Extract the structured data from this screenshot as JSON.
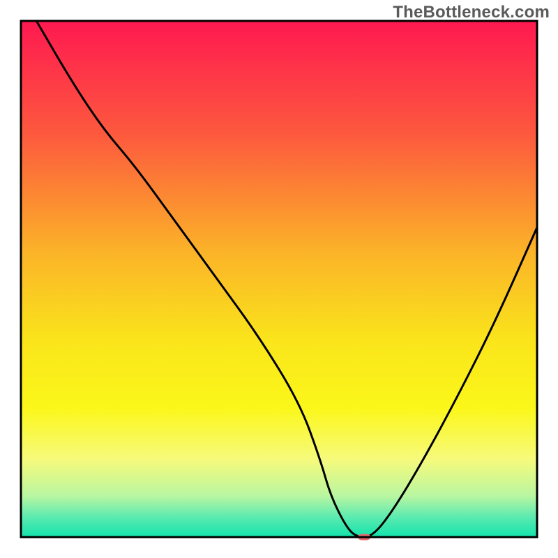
{
  "watermark": "TheBottleneck.com",
  "chart_data": {
    "type": "line",
    "title": "",
    "xlabel": "",
    "ylabel": "",
    "xlim": [
      0,
      100
    ],
    "ylim": [
      0,
      100
    ],
    "gradient_stops": [
      {
        "offset": 0,
        "color": "#fe1950"
      },
      {
        "offset": 22,
        "color": "#fd593e"
      },
      {
        "offset": 45,
        "color": "#fbb428"
      },
      {
        "offset": 62,
        "color": "#fae51b"
      },
      {
        "offset": 75,
        "color": "#fbf71a"
      },
      {
        "offset": 85,
        "color": "#f6fa7c"
      },
      {
        "offset": 92,
        "color": "#b9f6a1"
      },
      {
        "offset": 96,
        "color": "#5eebb0"
      },
      {
        "offset": 100,
        "color": "#12e3ac"
      }
    ],
    "series": [
      {
        "name": "bottleneck-curve",
        "color": "#000000",
        "x": [
          3,
          10,
          16,
          22,
          30,
          38,
          46,
          54,
          58,
          60,
          63,
          65,
          68,
          72,
          78,
          85,
          92,
          100
        ],
        "y": [
          100,
          88,
          79,
          72,
          61,
          50,
          39,
          26,
          15,
          8,
          2,
          0,
          0,
          5,
          15,
          28,
          42,
          60
        ]
      }
    ],
    "marker": {
      "name": "optimal-point",
      "x": 66.5,
      "y": 0,
      "color": "#e66a6a",
      "width_pct": 2.5,
      "height_pct": 1.2
    },
    "frame": {
      "stroke": "#000000",
      "stroke_width": 3
    }
  }
}
